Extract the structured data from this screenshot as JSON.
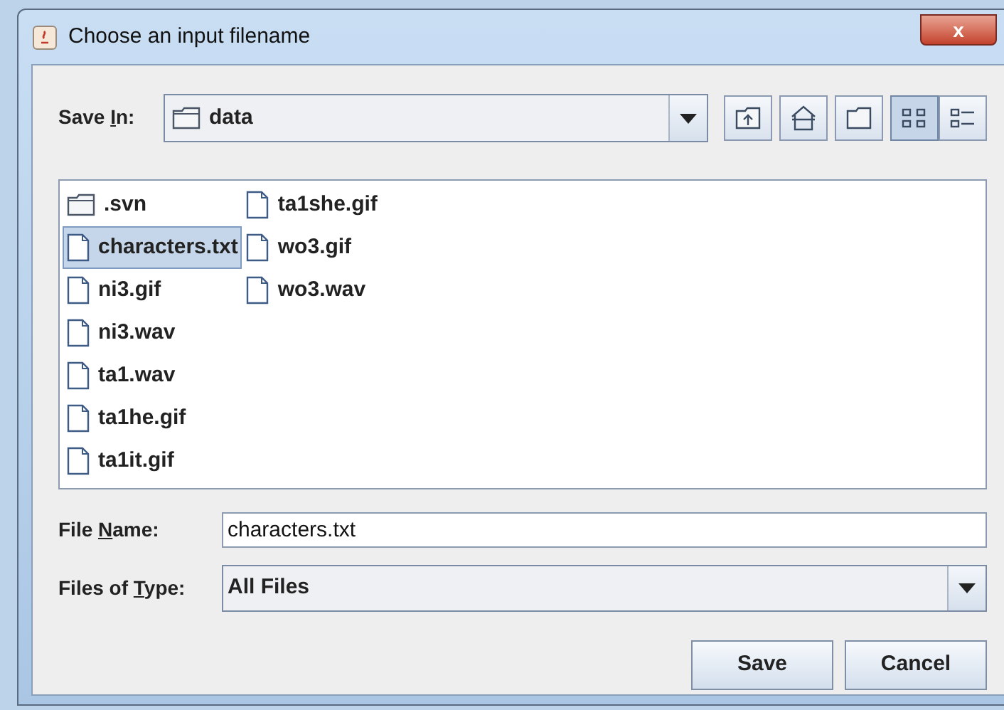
{
  "window": {
    "title": "Choose an input filename",
    "close": "x"
  },
  "save_in": {
    "label": {
      "before": "Save ",
      "key": "I",
      "after": "n:"
    },
    "value": "data"
  },
  "toolbar": [
    {
      "kind": "up",
      "selected": false
    },
    {
      "kind": "home",
      "selected": false
    },
    {
      "kind": "new-folder",
      "selected": false
    },
    {
      "kind": "list",
      "selected": true
    },
    {
      "kind": "details",
      "selected": false
    }
  ],
  "files": [
    {
      "name": ".svn",
      "kind": "folder",
      "selected": false
    },
    {
      "name": "characters.txt",
      "kind": "file",
      "selected": true
    },
    {
      "name": "ni3.gif",
      "kind": "file",
      "selected": false
    },
    {
      "name": "ni3.wav",
      "kind": "file",
      "selected": false
    },
    {
      "name": "ta1.wav",
      "kind": "file",
      "selected": false
    },
    {
      "name": "ta1he.gif",
      "kind": "file",
      "selected": false
    },
    {
      "name": "ta1it.gif",
      "kind": "file",
      "selected": false
    },
    {
      "name": "ta1she.gif",
      "kind": "file",
      "selected": false
    },
    {
      "name": "wo3.gif",
      "kind": "file",
      "selected": false
    },
    {
      "name": "wo3.wav",
      "kind": "file",
      "selected": false
    }
  ],
  "file_name": {
    "label": {
      "before": "File ",
      "key": "N",
      "after": "ame:"
    },
    "value": "characters.txt"
  },
  "file_type": {
    "label": {
      "before": "Files of ",
      "key": "T",
      "after": "ype:"
    },
    "value": "All Files"
  },
  "buttons": [
    "Save",
    "Cancel"
  ]
}
